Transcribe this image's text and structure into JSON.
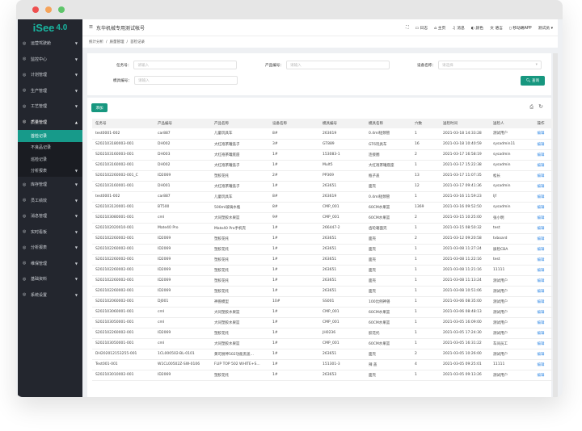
{
  "app": {
    "logo": "iSee",
    "version": "4.0",
    "title": "东华机械专用测试帐号"
  },
  "header": {
    "items": [
      {
        "icon": "calendar-icon",
        "label": "日志"
      },
      {
        "icon": "home-icon",
        "label": "主页"
      },
      {
        "icon": "bell-icon",
        "label": "消息"
      },
      {
        "icon": "contrast-icon",
        "label": "颜色"
      },
      {
        "icon": "translate-icon",
        "label": "语言"
      },
      {
        "icon": "mobile-icon",
        "label": "移动端APP"
      }
    ],
    "user": "测试员"
  },
  "breadcrumb": [
    "统计分析",
    "质量管理",
    "首检记录"
  ],
  "sidebar": {
    "items": [
      {
        "label": "运营驾驶舱"
      },
      {
        "label": "监控中心"
      },
      {
        "label": "计划管理"
      },
      {
        "label": "生产管理"
      },
      {
        "label": "工艺管理"
      },
      {
        "label": "质量管理",
        "expanded": true
      }
    ],
    "sub": [
      {
        "label": "首检记录",
        "active": true
      },
      {
        "label": "不良品记录"
      },
      {
        "label": "巡检记录"
      },
      {
        "label": "分析报表"
      }
    ],
    "items2": [
      {
        "label": "库存管理"
      },
      {
        "label": "员工绩效"
      },
      {
        "label": "消息管理"
      },
      {
        "label": "实时看板"
      },
      {
        "label": "分析报表"
      },
      {
        "label": "维保管理"
      },
      {
        "label": "基础资料"
      },
      {
        "label": "系统设置"
      }
    ]
  },
  "filter": {
    "task_label": "任务号：",
    "task_ph": "请输入",
    "product_label": "产品编号：",
    "product_ph": "请输入",
    "device_label": "设备名称：",
    "device_ph": "请选择",
    "mold_label": "模具编号：",
    "mold_ph": "请输入",
    "search": "查询"
  },
  "toolbar": {
    "add": "添加"
  },
  "table": {
    "headers": [
      "任务号",
      "产品编号",
      "产品名称",
      "设备名称",
      "模具编号",
      "模具名称",
      "穴数",
      "送检时间",
      "送检人",
      "操作"
    ],
    "action": "编辑",
    "rows": [
      [
        "test0001-002",
        "car887",
        "儿童玩具车",
        "8#",
        "263619",
        "0.4ml短颈管",
        "1",
        "2021-03-18 14:33:28",
        "测试用户"
      ],
      [
        "S202103180003-001",
        "DH002",
        "大红袍茶罐盖子",
        "3#",
        "GT889",
        "GT6玩具车",
        "16",
        "2021-03-18 10:40:59",
        "sysadmin11"
      ],
      [
        "S202103160003-001",
        "DH003",
        "大红袍茶罐底座",
        "1#",
        "153083-1",
        "连接圈",
        "2",
        "2021-03-17 16:58:19",
        "sysadmin"
      ],
      [
        "S202103160002-001",
        "DH002",
        "大红袍茶罐盖子",
        "1#",
        "Mult5",
        "大红袍茶罐底座",
        "1",
        "2021-03-17 15:22:38",
        "sysadmin"
      ],
      [
        "S202102260002-001_C",
        "ID2069",
        "塑胶花托",
        "2#",
        "PP369",
        "瓶子盖",
        "13",
        "2021-03-17 11:07:35",
        "松长"
      ],
      [
        "S202103160001-001",
        "DH001",
        "大红袍茶罐盖子",
        "1#",
        "263651",
        "面壳",
        "12",
        "2021-03-17 09:41:36",
        "sysadmin"
      ],
      [
        "test0001-002",
        "car887",
        "儿童玩具车",
        "8#",
        "263619",
        "0.4ml短颈管",
        "1",
        "2021-03-16 11:59:23",
        "ljf"
      ],
      [
        "S202103120001-001",
        "BT500",
        "500ml玻璃水瓶",
        "8#",
        "CMP_001",
        "60CM水果篮",
        "1369",
        "2021-03-16 09:52:50",
        "sysadmin"
      ],
      [
        "S202103080001-001",
        "cml",
        "大同塑胶水果篮",
        "9#",
        "CMP_001",
        "60CM水果篮",
        "2",
        "2021-03-15 10:25:00",
        "张小明"
      ],
      [
        "S202102020010-001",
        "Mate40 Pro",
        "Mate40 Pro手机壳",
        "1#",
        "266447-2",
        "齿轮箱面壳",
        "1",
        "2021-03-15 08:50:32",
        "test"
      ],
      [
        "S202102260002-001",
        "ID2069",
        "塑胶花托",
        "1#",
        "263651",
        "面壳",
        "2",
        "2021-03-12 09:20:58",
        "tvboard"
      ],
      [
        "S202102260002-001",
        "ID2069",
        "塑胶花托",
        "1#",
        "263651",
        "面壳",
        "1",
        "2021-03-08 11:27:24",
        "质检CBA"
      ],
      [
        "S202102260002-001",
        "ID2069",
        "塑胶花托",
        "1#",
        "263651",
        "面壳",
        "1",
        "2021-03-08 11:22:16",
        "test"
      ],
      [
        "S202102260002-001",
        "ID2069",
        "塑胶花托",
        "1#",
        "263651",
        "面壳",
        "1",
        "2021-03-08 11:21:16",
        "11111"
      ],
      [
        "S202102260002-001",
        "ID2069",
        "塑胶花托",
        "1#",
        "263651",
        "面壳",
        "1",
        "2021-03-08 11:13:24",
        "测试用户"
      ],
      [
        "S202102260002-001",
        "ID2069",
        "塑胶花托",
        "1#",
        "263651",
        "面壳",
        "1",
        "2021-03-08 10:51:06",
        "测试用户"
      ],
      [
        "S202102060002-001",
        "DJ001",
        "神兽模型",
        "10#",
        "SS001",
        "100比例神兽",
        "1",
        "2021-03-06 08:35:00",
        "测试用户"
      ],
      [
        "S202103060001-001",
        "cml",
        "大同塑胶水果篮",
        "1#",
        "CMP_001",
        "60CM水果篮",
        "1",
        "2021-03-06 08:48:13",
        "测试用户"
      ],
      [
        "S202103050001-001",
        "cml",
        "大同塑胶水果篮",
        "1#",
        "CMP_001",
        "60CM水果篮",
        "1",
        "2021-03-05 16:09:00",
        "测试用户"
      ],
      [
        "S202102260002-001",
        "ID2069",
        "塑胶花托",
        "1#",
        "JH0236",
        "胶花托",
        "1",
        "2021-03-05 17:24:30",
        "测试用户"
      ],
      [
        "S202103050001-001",
        "cml",
        "大同塑胶水果篮",
        "1#",
        "CMP_001",
        "60CM水果篮",
        "1",
        "2021-03-05 16:31:22",
        "车间员工"
      ],
      [
        "DH202012153255-001",
        "1CL000502-BL-0101",
        "黄可厨神502功能黑盖...",
        "1#",
        "263651",
        "面壳",
        "2",
        "2021-03-05 10:26:00",
        "测试用户"
      ],
      [
        "Test001-001",
        "W1CL00502Z-SW-0106",
        "FLIP TOP 502 WHITE+S...",
        "1#",
        "151301-3",
        "辣 盖",
        "4",
        "2021-03-05 09:25:01",
        "11111"
      ],
      [
        "S202103010002-001",
        "ID2069",
        "塑胶花托",
        "1#",
        "263653",
        "面壳",
        "1",
        "2021-03-05 09:13:26",
        "测试用户"
      ]
    ]
  },
  "colors": {
    "accent": "#17977f",
    "sidebar": "#23262e",
    "link": "#3a8ee6"
  }
}
